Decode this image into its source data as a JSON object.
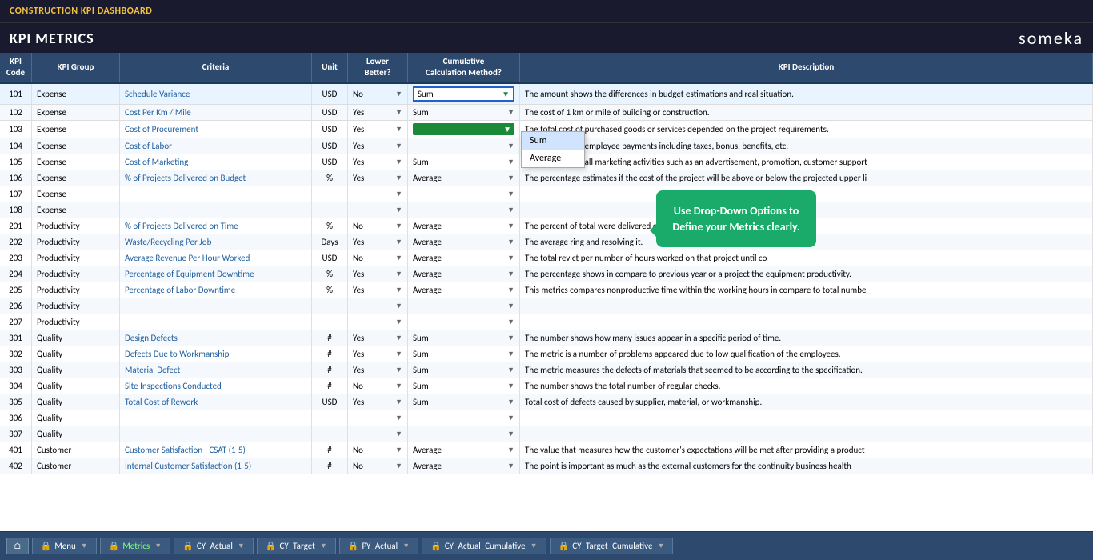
{
  "topBar": {
    "title": "CONSTRUCTION KPI DASHBOARD"
  },
  "header": {
    "title": "KPI METRICS",
    "logo": "someka"
  },
  "columns": [
    {
      "key": "kpi_code",
      "label": "KPI\nCode"
    },
    {
      "key": "kpi_group",
      "label": "KPI Group"
    },
    {
      "key": "criteria",
      "label": "Criteria"
    },
    {
      "key": "unit",
      "label": "Unit"
    },
    {
      "key": "lower_better",
      "label": "Lower\nBetter?"
    },
    {
      "key": "calc_method",
      "label": "Cumulative\nCalculation Method?"
    },
    {
      "key": "description",
      "label": "KPI Description"
    }
  ],
  "dropdownOptions": [
    "Sum",
    "Average"
  ],
  "tooltip": {
    "text": "Use Drop-Down Options to Define your Metrics clearly."
  },
  "rows": [
    {
      "code": "101",
      "group": "Expense",
      "criteria": "Schedule Variance",
      "unit": "USD",
      "lower": "No",
      "method": "Sum",
      "desc": "The amount shows the differences in budget estimations and real situation.",
      "active": true,
      "inputActive": true
    },
    {
      "code": "102",
      "group": "Expense",
      "criteria": "Cost Per Km / Mile",
      "unit": "USD",
      "lower": "Yes",
      "method": "Sum",
      "desc": "The cost of 1 km or mile of building or construction.",
      "dropdownOpen": true
    },
    {
      "code": "103",
      "group": "Expense",
      "criteria": "Cost of Procurement",
      "unit": "USD",
      "lower": "Yes",
      "method": "",
      "desc": "The total cost of purchased goods or services depended on the project requirements.",
      "dropdownOpen2": true
    },
    {
      "code": "104",
      "group": "Expense",
      "criteria": "Cost of Labor",
      "unit": "USD",
      "lower": "Yes",
      "method": "",
      "desc": "The total cost of employee payments including taxes, bonus, benefits, etc."
    },
    {
      "code": "105",
      "group": "Expense",
      "criteria": "Cost of Marketing",
      "unit": "USD",
      "lower": "Yes",
      "method": "Sum",
      "desc": "The total cost of all marketing activities such as an advertisement, promotion, customer support"
    },
    {
      "code": "106",
      "group": "Expense",
      "criteria": "% of Projects Delivered on Budget",
      "unit": "%",
      "lower": "Yes",
      "method": "Average",
      "desc": "The percentage estimates if the cost of the project will be above or below the projected upper li"
    },
    {
      "code": "107",
      "group": "Expense",
      "criteria": "",
      "unit": "",
      "lower": "",
      "method": "",
      "desc": ""
    },
    {
      "code": "108",
      "group": "Expense",
      "criteria": "",
      "unit": "",
      "lower": "",
      "method": "",
      "desc": ""
    },
    {
      "code": "201",
      "group": "Productivity",
      "criteria": "% of Projects Delivered on Time",
      "unit": "%",
      "lower": "No",
      "method": "Average",
      "desc": "The percent of total were delivered on time."
    },
    {
      "code": "202",
      "group": "Productivity",
      "criteria": "Waste/Recycling Per Job",
      "unit": "Days",
      "lower": "Yes",
      "method": "Average",
      "desc": "The average ring and resolving it."
    },
    {
      "code": "203",
      "group": "Productivity",
      "criteria": "Average Revenue Per Hour Worked",
      "unit": "USD",
      "lower": "No",
      "method": "Average",
      "desc": "The total rev ct per number of hours worked on that project until co"
    },
    {
      "code": "204",
      "group": "Productivity",
      "criteria": "Percentage of Equipment Downtime",
      "unit": "%",
      "lower": "Yes",
      "method": "Average",
      "desc": "The percentage shows in compare to previous year or a project the equipment productivity."
    },
    {
      "code": "205",
      "group": "Productivity",
      "criteria": "Percentage of Labor Downtime",
      "unit": "%",
      "lower": "Yes",
      "method": "Average",
      "desc": "This metrics compares nonproductive time within the working hours in compare to total numbe"
    },
    {
      "code": "206",
      "group": "Productivity",
      "criteria": "",
      "unit": "",
      "lower": "",
      "method": "",
      "desc": ""
    },
    {
      "code": "207",
      "group": "Productivity",
      "criteria": "",
      "unit": "",
      "lower": "",
      "method": "",
      "desc": ""
    },
    {
      "code": "301",
      "group": "Quality",
      "criteria": "Design Defects",
      "unit": "#",
      "lower": "Yes",
      "method": "Sum",
      "desc": "The number shows how many issues appear in a specific period of time."
    },
    {
      "code": "302",
      "group": "Quality",
      "criteria": "Defects Due to Workmanship",
      "unit": "#",
      "lower": "Yes",
      "method": "Sum",
      "desc": "The metric is a number of problems appeared due to low qualification of the employees."
    },
    {
      "code": "303",
      "group": "Quality",
      "criteria": "Material Defect",
      "unit": "#",
      "lower": "Yes",
      "method": "Sum",
      "desc": "The metric measures the defects of materials that seemed to be according to the specification."
    },
    {
      "code": "304",
      "group": "Quality",
      "criteria": "Site Inspections Conducted",
      "unit": "#",
      "lower": "No",
      "method": "Sum",
      "desc": "The number shows the total number of regular checks."
    },
    {
      "code": "305",
      "group": "Quality",
      "criteria": "Total Cost of Rework",
      "unit": "USD",
      "lower": "Yes",
      "method": "Sum",
      "desc": "Total cost of defects caused by supplier, material, or workmanship."
    },
    {
      "code": "306",
      "group": "Quality",
      "criteria": "",
      "unit": "",
      "lower": "",
      "method": "",
      "desc": ""
    },
    {
      "code": "307",
      "group": "Quality",
      "criteria": "",
      "unit": "",
      "lower": "",
      "method": "",
      "desc": ""
    },
    {
      "code": "401",
      "group": "Customer",
      "criteria": "Customer Satisfaction - CSAT (1-5)",
      "unit": "#",
      "lower": "No",
      "method": "Average",
      "desc": "The value that measures how the customer's expectations will be met after providing a product"
    },
    {
      "code": "402",
      "group": "Customer",
      "criteria": "Internal Customer Satisfaction (1-5)",
      "unit": "#",
      "lower": "No",
      "method": "Average",
      "desc": "The point is important as much as the external customers for the continuity business health"
    }
  ],
  "bottomBar": {
    "home": "⌂",
    "buttons": [
      {
        "label": "Menu",
        "icon": "🔒"
      },
      {
        "label": "Metrics",
        "icon": "🔒"
      },
      {
        "label": "CY_Actual",
        "icon": "🔒"
      },
      {
        "label": "CY_Target",
        "icon": "🔒"
      },
      {
        "label": "PY_Actual",
        "icon": "🔒"
      },
      {
        "label": "CY_Actual_Cumulative",
        "icon": "🔒"
      },
      {
        "label": "CY_Target_Cumulative",
        "icon": "🔒"
      }
    ]
  }
}
